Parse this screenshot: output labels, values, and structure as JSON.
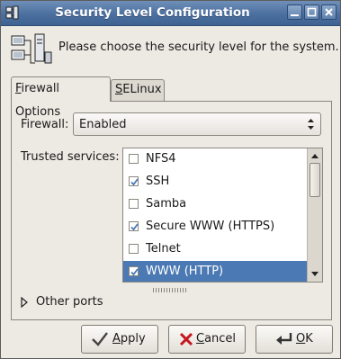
{
  "window": {
    "title": "Security Level Configuration",
    "title_bar_color": "#4b6f9f"
  },
  "header": {
    "message": "Please choose the security level for the system."
  },
  "tabs": [
    {
      "label": "Firewall Options",
      "mnemonic": "F",
      "active": true
    },
    {
      "label": "SELinux",
      "mnemonic": "S",
      "active": false
    }
  ],
  "firewall": {
    "label": "Firewall:",
    "value": "Enabled"
  },
  "trusted_services": {
    "label": "Trusted services:",
    "items": [
      {
        "label": "NFS4",
        "checked": false,
        "selected": false
      },
      {
        "label": "SSH",
        "checked": true,
        "selected": false
      },
      {
        "label": "Samba",
        "checked": false,
        "selected": false
      },
      {
        "label": "Secure WWW (HTTPS)",
        "checked": true,
        "selected": false
      },
      {
        "label": "Telnet",
        "checked": false,
        "selected": false
      },
      {
        "label": "WWW (HTTP)",
        "checked": true,
        "selected": true
      }
    ],
    "selection_color": "#4b79b3"
  },
  "other_ports": {
    "label": "Other ports",
    "expanded": false
  },
  "buttons": {
    "apply": {
      "label": "Apply",
      "mnemonic": "A"
    },
    "cancel": {
      "label": "Cancel",
      "mnemonic": "C"
    },
    "ok": {
      "label": "OK",
      "mnemonic": "O"
    }
  },
  "icons": {
    "window": "security-icon",
    "header": "computer-network-icon",
    "apply": "checkmark-icon",
    "cancel": "red-x-icon",
    "ok": "enter-arrow-icon"
  }
}
